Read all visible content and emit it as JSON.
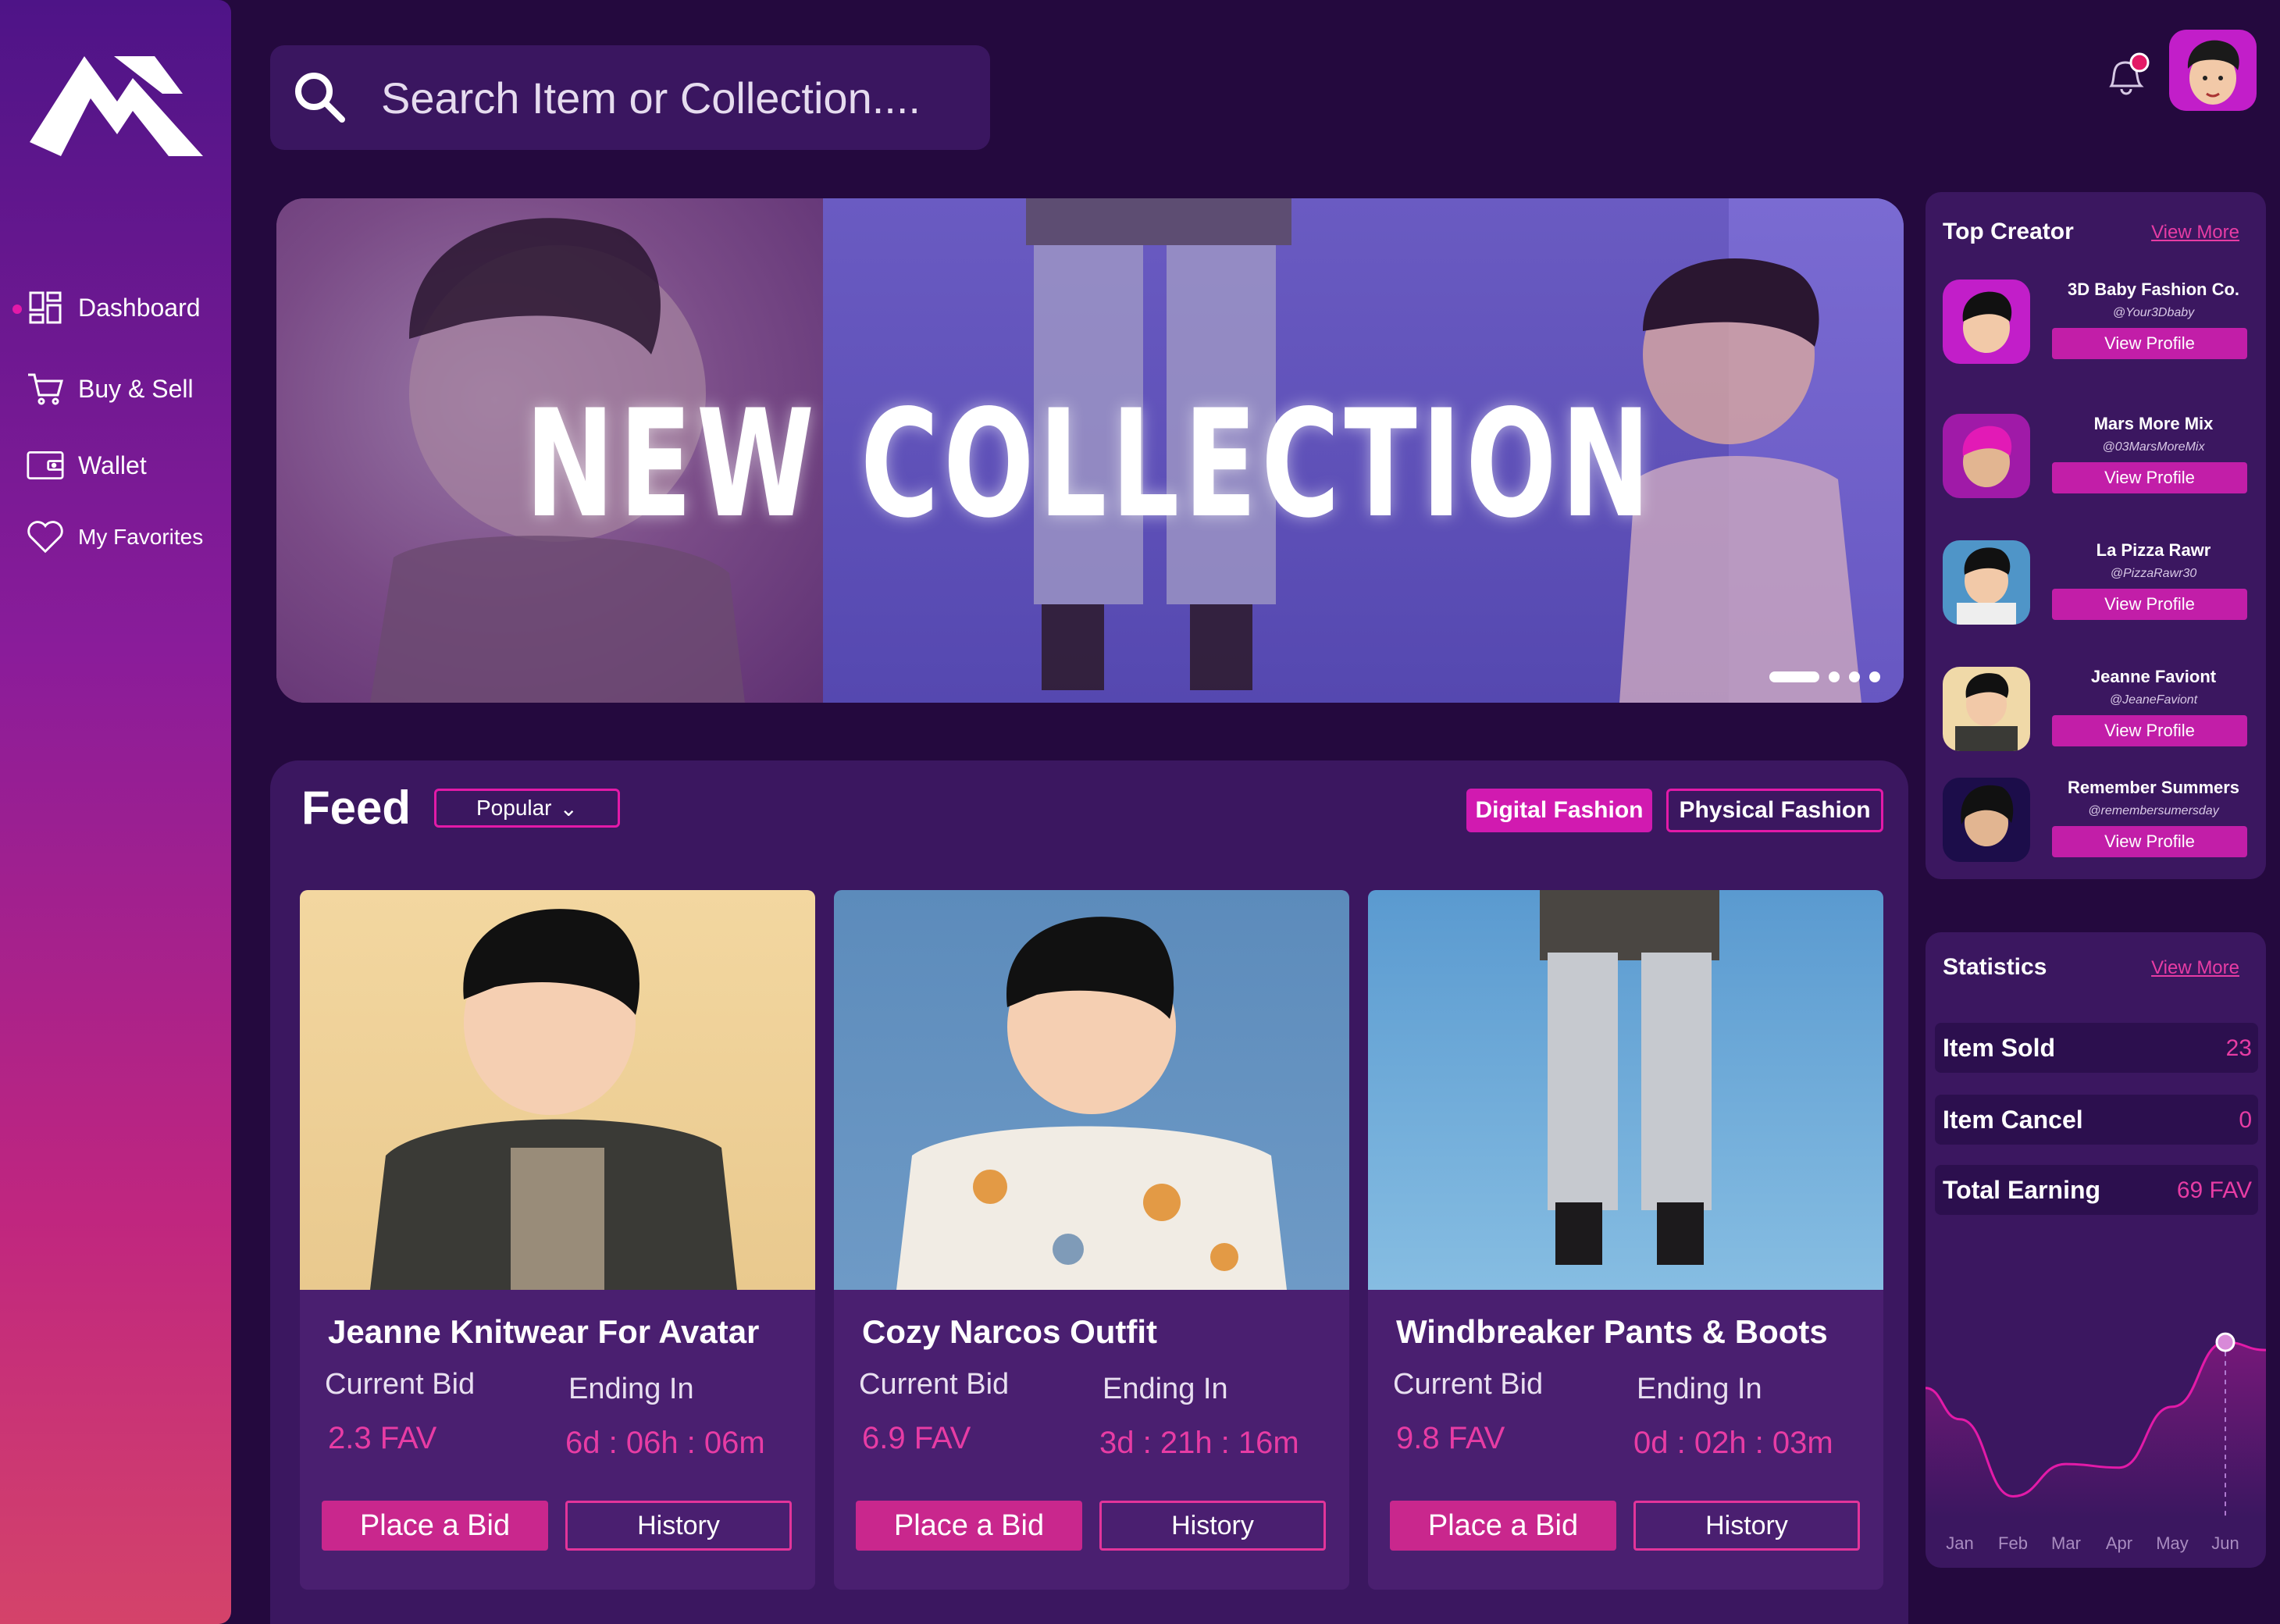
{
  "search": {
    "placeholder": "Search Item or Collection...."
  },
  "sidebar": {
    "items": [
      {
        "label": "Dashboard",
        "icon": "dashboard-icon",
        "active": true
      },
      {
        "label": "Buy & Sell",
        "icon": "cart-icon"
      },
      {
        "label": "Wallet",
        "icon": "wallet-icon"
      },
      {
        "label": "My Favorites",
        "icon": "heart-icon"
      }
    ]
  },
  "header": {
    "notification_icon": "bell-icon",
    "has_notification": true
  },
  "banner": {
    "title": "NEW COLLECTION",
    "slides": 4,
    "active_slide": 1
  },
  "feed": {
    "title": "Feed",
    "sort": "Popular",
    "tabs": [
      {
        "label": "Digital Fashion",
        "active": true
      },
      {
        "label": "Physical Fashion",
        "active": false
      }
    ],
    "cards": [
      {
        "name": "Jeanne Knitwear For Avatar",
        "bid_label": "Current Bid",
        "bid": "2.3 FAV",
        "ending_label": "Ending In",
        "ending": "6d : 06h : 06m",
        "bid_button": "Place a Bid",
        "history_button": "History"
      },
      {
        "name": "Cozy Narcos Outfit",
        "bid_label": "Current Bid",
        "bid": "6.9 FAV",
        "ending_label": "Ending In",
        "ending": "3d : 21h : 16m",
        "bid_button": "Place a Bid",
        "history_button": "History"
      },
      {
        "name": "Windbreaker Pants & Boots",
        "bid_label": "Current Bid",
        "bid": "9.8 FAV",
        "ending_label": "Ending In",
        "ending": "0d : 02h : 03m",
        "bid_button": "Place a Bid",
        "history_button": "History"
      }
    ]
  },
  "top_creator": {
    "title": "Top Creator",
    "view_more": "View More",
    "creators": [
      {
        "name": "3D Baby Fashion Co.",
        "handle": "@Your3Dbaby",
        "button": "View Profile"
      },
      {
        "name": "Mars More Mix",
        "handle": "@03MarsMoreMix",
        "button": "View Profile"
      },
      {
        "name": "La Pizza Rawr",
        "handle": "@PizzaRawr30",
        "button": "View Profile"
      },
      {
        "name": "Jeanne Faviont",
        "handle": "@JeaneFaviont",
        "button": "View Profile"
      },
      {
        "name": "Remember Summers",
        "handle": "@remembersumersday",
        "button": "View Profile"
      }
    ]
  },
  "statistics": {
    "title": "Statistics",
    "view_more": "View More",
    "rows": [
      {
        "label": "Item Sold",
        "value": "23"
      },
      {
        "label": "Item Cancel",
        "value": "0"
      },
      {
        "label": "Total Earning",
        "value": "69 FAV"
      }
    ],
    "chart_data": {
      "type": "area",
      "x": [
        "Jan",
        "Feb",
        "Mar",
        "Apr",
        "May",
        "Jun"
      ],
      "series": [
        {
          "values": [
            0.55,
            0.12,
            0.3,
            0.28,
            0.62,
            0.98
          ]
        }
      ],
      "highlight_index": 5,
      "color": "#e31aa8"
    }
  },
  "colors": {
    "accent": "#e31aa8",
    "background": "#24093e",
    "panel": "#3b1760"
  }
}
